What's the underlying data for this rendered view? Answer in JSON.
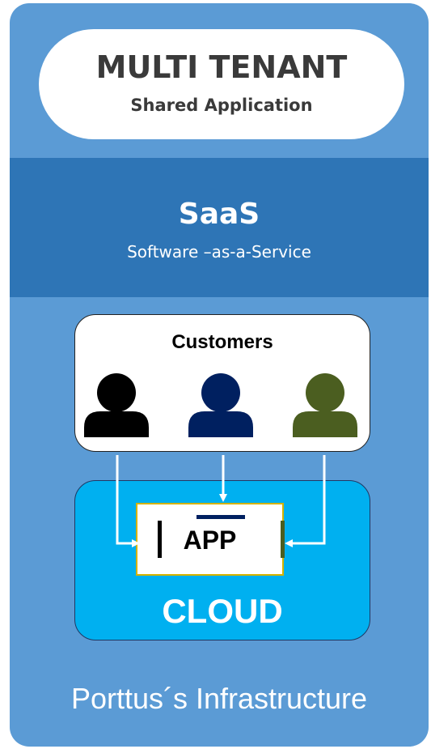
{
  "header": {
    "title": "MULTI TENANT",
    "subtitle": "Shared Application"
  },
  "band": {
    "title": "SaaS",
    "subtitle": "Software –as-a-Service"
  },
  "customers": {
    "label": "Customers",
    "users": [
      {
        "icon": "user-icon",
        "color": "#000000"
      },
      {
        "icon": "user-icon",
        "color": "#002060"
      },
      {
        "icon": "user-icon",
        "color": "#4b5e20"
      }
    ]
  },
  "app": {
    "label": "APP",
    "left_bar_color": "#000000",
    "top_bar_color": "#002060",
    "right_bar_color": "#4b5e20",
    "border_color": "#d4b200"
  },
  "cloud": {
    "label": "CLOUD",
    "color": "#00b0f0"
  },
  "footer": {
    "label": "Porttus´s Infrastructure"
  },
  "colors": {
    "panel": "#5b9bd5",
    "band": "#2e75b6",
    "arrow": "#ffffff"
  }
}
